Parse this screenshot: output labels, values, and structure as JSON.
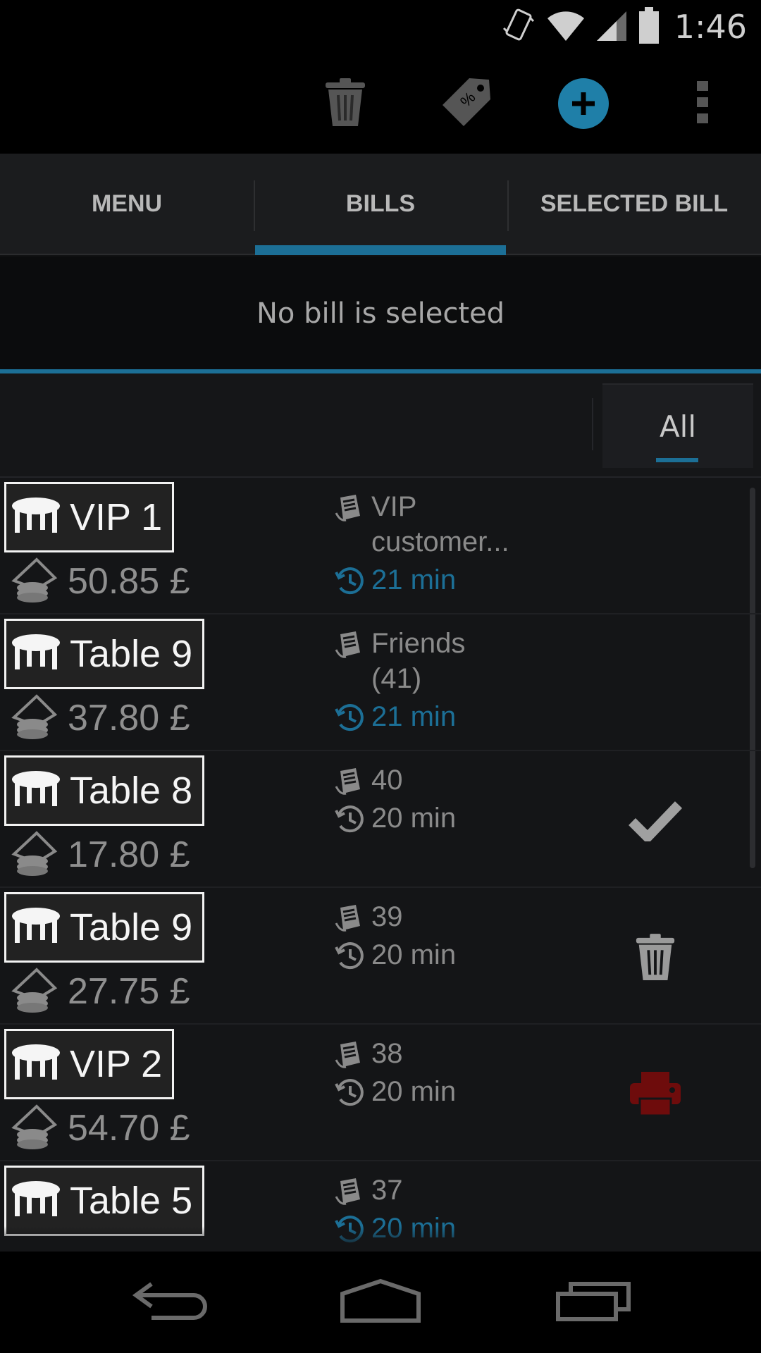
{
  "status_bar": {
    "time": "1:46"
  },
  "action_bar": {
    "delete_icon": "trash-icon",
    "discount_icon": "discount-tag-icon",
    "add_icon": "add-circle-icon",
    "overflow_icon": "overflow-menu-icon",
    "accent_color": "#1f7fa8"
  },
  "tabs": [
    {
      "label": "MENU",
      "active": false
    },
    {
      "label": "BILLS",
      "active": true
    },
    {
      "label": "SELECTED BILL",
      "active": false
    }
  ],
  "selected_bill": {
    "message": "No bill is selected"
  },
  "filter": {
    "label": "All"
  },
  "bills": [
    {
      "table": "VIP 1",
      "amount": "50.85 £",
      "note_lines": [
        "VIP",
        "customer..."
      ],
      "elapsed": "21 min",
      "elapsed_highlight": true,
      "action": ""
    },
    {
      "table": "Table 9",
      "amount": "37.80 £",
      "note_lines": [
        "Friends",
        "(41)"
      ],
      "elapsed": "21 min",
      "elapsed_highlight": true,
      "action": ""
    },
    {
      "table": "Table 8",
      "amount": "17.80 £",
      "note_lines": [
        "40"
      ],
      "elapsed": "20 min",
      "elapsed_highlight": false,
      "action": "check-icon"
    },
    {
      "table": "Table 9",
      "amount": "27.75 £",
      "note_lines": [
        "39"
      ],
      "elapsed": "20 min",
      "elapsed_highlight": false,
      "action": "trash-icon"
    },
    {
      "table": "VIP 2",
      "amount": "54.70 £",
      "note_lines": [
        "38"
      ],
      "elapsed": "20 min",
      "elapsed_highlight": false,
      "action": "printer-icon"
    },
    {
      "table": "Table 5",
      "amount": "",
      "note_lines": [
        "37"
      ],
      "elapsed": "20 min",
      "elapsed_highlight": true,
      "action": ""
    }
  ],
  "nav_bar": {
    "back_icon": "back-icon",
    "home_icon": "home-icon",
    "recents_icon": "recents-icon"
  }
}
